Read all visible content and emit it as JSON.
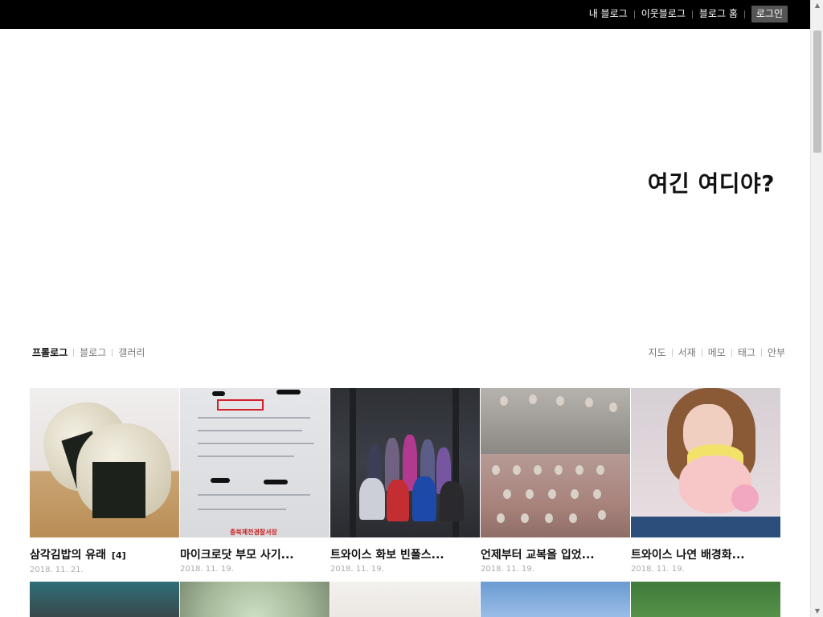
{
  "topbar": {
    "links": [
      "내 블로그",
      "이웃블로그",
      "블로그 홈"
    ],
    "login_label": "로그인"
  },
  "blog": {
    "title": "여긴 여디야?"
  },
  "menu": {
    "left": [
      "프롤로그",
      "블로그",
      "갤러리"
    ],
    "right": [
      "지도",
      "서재",
      "메모",
      "태그",
      "안부"
    ]
  },
  "gallery": {
    "items": [
      {
        "title": "삼각김밥의 유래",
        "count": "[4]",
        "date": "2018. 11. 21."
      },
      {
        "title": "마이크로닷 부모 사기...",
        "count": "",
        "date": "2018. 11. 19."
      },
      {
        "title": "트와이스 화보 빈폴스...",
        "count": "",
        "date": "2018. 11. 19."
      },
      {
        "title": "언제부터 교복을 입었...",
        "count": "",
        "date": "2018. 11. 19."
      },
      {
        "title": "트와이스 나연 배경화...",
        "count": "",
        "date": "2018. 11. 19."
      }
    ],
    "doc_stamp": "충북제천경찰서장"
  }
}
